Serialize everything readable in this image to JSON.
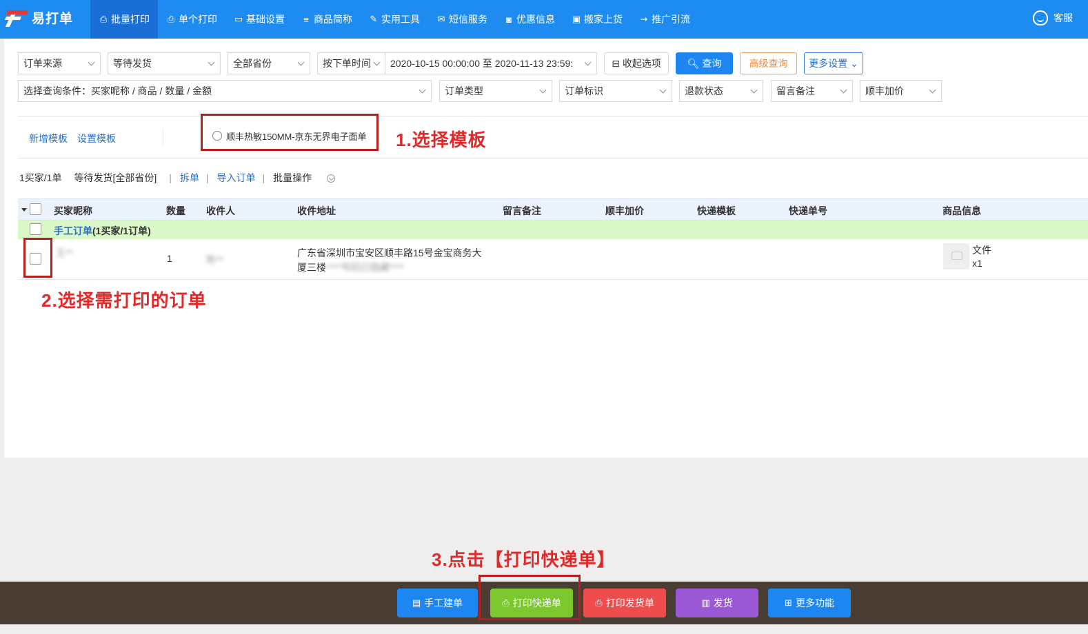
{
  "app": {
    "name": "易打单",
    "service_label": "客服"
  },
  "colors": {
    "nav_bg": "#1e8bf0",
    "nav_active": "#1a6fd6",
    "annotation_red": "#e02a2a",
    "group_row_bg": "#d9f7c7",
    "bottom_bar": "#4a3d34"
  },
  "nav": [
    {
      "label": "批量打印",
      "icon": "printer-icon",
      "glyph": "⎙",
      "active": true
    },
    {
      "label": "单个打印",
      "icon": "printer-icon",
      "glyph": "⎙",
      "active": false
    },
    {
      "label": "基础设置",
      "icon": "monitor-icon",
      "glyph": "▭",
      "active": false
    },
    {
      "label": "商品简称",
      "icon": "list-icon",
      "glyph": "≡",
      "active": false
    },
    {
      "label": "实用工具",
      "icon": "wrench-icon",
      "glyph": "✎",
      "active": false
    },
    {
      "label": "短信服务",
      "icon": "envelope-icon",
      "glyph": "✉",
      "active": false
    },
    {
      "label": "优惠信息",
      "icon": "ticket-icon",
      "glyph": "◙",
      "active": false
    },
    {
      "label": "搬家上货",
      "icon": "bag-icon",
      "glyph": "▣",
      "active": false
    },
    {
      "label": "推广引流",
      "icon": "car-icon",
      "glyph": "⇝",
      "active": false
    }
  ],
  "filters": {
    "order_source": "订单来源",
    "status": "等待发货",
    "province": "全部省份",
    "time_type": "按下单时间",
    "date_range": "2020-10-15 00:00:00 至 2020-11-13 23:59:",
    "collapse_label": "收起选项",
    "query_label": "查询",
    "advanced_label": "高级查询",
    "more_settings_label": "更多设置",
    "condition": "选择查询条件：买家昵称 / 商品 / 数量 / 金额",
    "order_type": "订单类型",
    "order_flag": "订单标识",
    "refund_status": "退款状态",
    "remark": "留言备注",
    "sf_extra": "顺丰加价"
  },
  "template": {
    "add_label": "新增模板",
    "settings_label": "设置模板",
    "option_label": "顺丰热敏150MM-京东无界电子面单"
  },
  "annotations": {
    "step1": "1.选择模板",
    "step2": "2.选择需打印的订单",
    "step3": "3.点击【打印快递单】"
  },
  "summary": {
    "count": "1买家/1单",
    "status": "等待发货[全部省份]",
    "split": "拆单",
    "import": "导入订单",
    "batch": "批量操作"
  },
  "table": {
    "headers": [
      "买家昵称",
      "数量",
      "收件人",
      "收件地址",
      "留言备注",
      "顺丰加价",
      "快递模板",
      "快递单号",
      "商品信息"
    ],
    "group_link": "手工订单",
    "group_suffix": "(1买家/1订单)",
    "rows": [
      {
        "buyer": "王**",
        "qty": "1",
        "receiver": "陈**",
        "address_line1": "广东省深圳市宝安区顺丰路15号金宝商务大",
        "address_line2_visible": "厦三楼",
        "address_line2_blur": "****号码已隐藏****",
        "product_name": "文件",
        "product_qty": "x1"
      }
    ]
  },
  "bottom": [
    {
      "label": "手工建单",
      "icon": "document-icon",
      "glyph": "▤",
      "color": "#1e86f0"
    },
    {
      "label": "打印快递单",
      "icon": "printer-icon",
      "glyph": "⎙",
      "color": "#7cc62e"
    },
    {
      "label": "打印发货单",
      "icon": "printer-icon",
      "glyph": "⎙",
      "color": "#ef4d4d"
    },
    {
      "label": "发货",
      "icon": "bus-icon",
      "glyph": "▥",
      "color": "#9b59d6"
    },
    {
      "label": "更多功能",
      "icon": "plus-square-icon",
      "glyph": "⊞",
      "color": "#1e86f0"
    }
  ]
}
